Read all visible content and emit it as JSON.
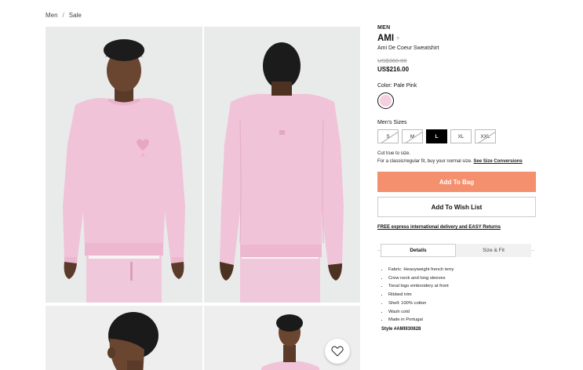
{
  "breadcrumb": {
    "items": [
      "Men",
      "Sale"
    ],
    "separator": "/"
  },
  "product": {
    "category": "MEN",
    "brand": "AMI",
    "brand_suffix": "+",
    "name": "Ami De Coeur Sweatshirt",
    "original_price": "US$360.00",
    "sale_price": "US$216.00",
    "color_label": "Color: Pale Pink",
    "swatch_color": "#f3cfe0",
    "sizes_label": "Men's Sizes",
    "sizes": [
      {
        "label": "S",
        "available": false,
        "selected": false
      },
      {
        "label": "M",
        "available": false,
        "selected": false
      },
      {
        "label": "L",
        "available": true,
        "selected": true
      },
      {
        "label": "XL",
        "available": true,
        "selected": false
      },
      {
        "label": "XXL",
        "available": false,
        "selected": false
      }
    ],
    "fit_note_1": "Cut true to size.",
    "fit_note_2": "For a classic/regular fit, buy your normal size.",
    "fit_note_link": "See Size Conversions",
    "add_to_bag": "Add To Bag",
    "add_to_wishlist": "Add To Wish List",
    "shipping": "FREE express international delivery and EASY Returns",
    "tabs": [
      "Details",
      "Size & Fit"
    ],
    "details": [
      "Fabric: Heavyweight french terry",
      "Crew neck and long sleeves",
      "Tonal logo embroidery at front",
      "Ribbed trim",
      "Shell: 100% cotton",
      "Wash cold",
      "Made in Portugal"
    ],
    "style_code": "Style #AMIII30828"
  },
  "colors": {
    "accent": "#f5906e",
    "sweatshirt": "#f1c3d8"
  },
  "icons": {
    "wishlist": "heart-outline-icon"
  }
}
